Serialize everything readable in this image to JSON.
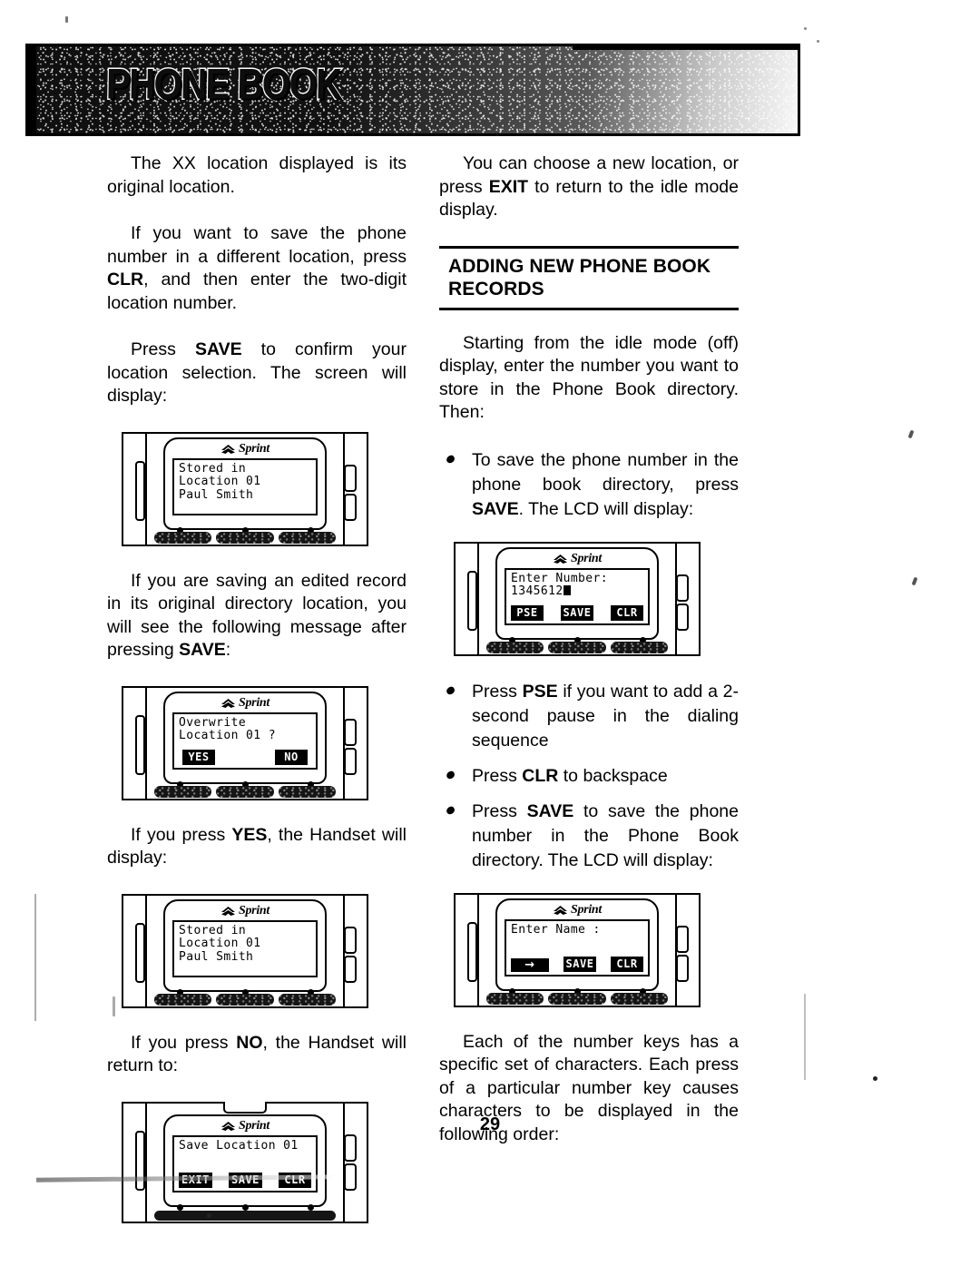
{
  "document": {
    "banner_title": "PHONE BOOK",
    "page_number": "29"
  },
  "left_column": {
    "p1": "The XX location displayed is its original location.",
    "p2_a": "If you want to save the phone number in a different location, press ",
    "p2_b": "CLR",
    "p2_c": ", and then enter the two-digit location number.",
    "p3_a": "Press ",
    "p3_b": "SAVE",
    "p3_c": " to confirm your location selection.  The screen will display:",
    "p4_a": "If you are saving an edited record in its original directory location, you will see the following message after pressing ",
    "p4_b": "SAVE",
    "p4_c": ":",
    "p5_a": "If you press ",
    "p5_b": "YES",
    "p5_c": ", the Handset will display:",
    "p6_a": "If you press ",
    "p6_b": "NO",
    "p6_c": ", the Handset will return to:"
  },
  "right_column": {
    "p1_a": "You can choose a new location, or press ",
    "p1_b": "EXIT",
    "p1_c": " to return to the idle mode display.",
    "section_heading": "ADDING NEW PHONE BOOK RECORDS",
    "p2": "Starting from the idle mode (off) display, enter the number you want to store in the Phone Book directory.  Then:",
    "bullets": [
      {
        "a": "To save the phone number in the phone book directory, press ",
        "b": "SAVE",
        "c": ".  The LCD will display:"
      },
      {
        "a": "Press ",
        "b": "PSE",
        "c": " if you want to add a 2-second pause in the dialing sequence"
      },
      {
        "a": "Press ",
        "b": "CLR",
        "c": " to backspace"
      },
      {
        "a": "Press ",
        "b": "SAVE",
        "c": " to save the phone number in the Phone Book directory.  The LCD will display:"
      }
    ],
    "p3": "Each of the number keys has a specific set of characters.  Each press of a particular number key causes characters to be displayed in the following order:"
  },
  "handsets": [
    {
      "id": "stored-in-location-01-paul-smith",
      "brand": "Sprint",
      "lcd_lines": [
        "Stored in",
        "Location 01",
        "Paul Smith"
      ],
      "soft_keys": []
    },
    {
      "id": "overwrite-location-01",
      "brand": "Sprint",
      "lcd_lines": [
        "Overwrite",
        "Location 01 ?"
      ],
      "soft_keys": [
        "YES",
        "NO"
      ]
    },
    {
      "id": "stored-in-location-01-paul-smith-2",
      "brand": "Sprint",
      "lcd_lines": [
        "Stored in",
        "Location 01",
        "Paul Smith"
      ],
      "soft_keys": []
    },
    {
      "id": "save-location-01",
      "brand": "Sprint",
      "lcd_lines": [
        "Save Location 01"
      ],
      "soft_keys": [
        "EXIT",
        "SAVE",
        "CLR"
      ]
    },
    {
      "id": "enter-number",
      "brand": "Sprint",
      "lcd_lines": [
        "Enter Number:",
        "1345612"
      ],
      "cursor": true,
      "soft_keys": [
        "PSE",
        "SAVE",
        "CLR"
      ]
    },
    {
      "id": "enter-name",
      "brand": "Sprint",
      "lcd_lines": [
        "Enter Name :"
      ],
      "soft_keys": [
        "→",
        "SAVE",
        "CLR"
      ]
    }
  ],
  "colors": {
    "ink": "#000000",
    "paper": "#ffffff",
    "banner": "#101010"
  }
}
